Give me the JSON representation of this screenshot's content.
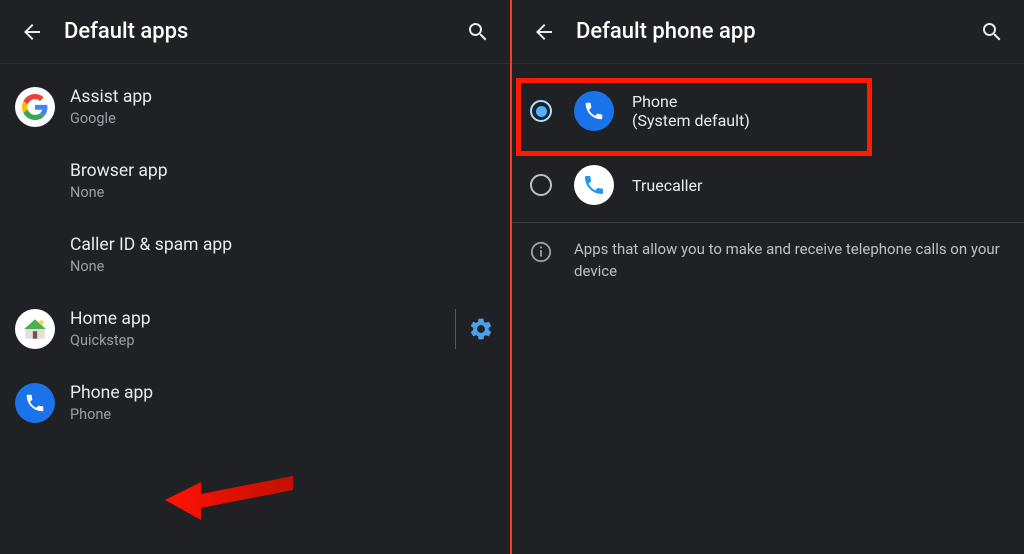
{
  "left": {
    "title": "Default apps",
    "items": [
      {
        "label": "Assist app",
        "value": "Google",
        "icon": "google"
      },
      {
        "label": "Browser app",
        "value": "None",
        "icon": ""
      },
      {
        "label": "Caller ID & spam app",
        "value": "None",
        "icon": ""
      },
      {
        "label": "Home app",
        "value": "Quickstep",
        "icon": "home",
        "gear": true
      },
      {
        "label": "Phone app",
        "value": "Phone",
        "icon": "phone-blue"
      }
    ]
  },
  "right": {
    "title": "Default phone app",
    "options": [
      {
        "label": "Phone",
        "sublabel": "(System default)",
        "icon": "phone-blue",
        "selected": true
      },
      {
        "label": "Truecaller",
        "sublabel": "",
        "icon": "truecaller",
        "selected": false
      }
    ],
    "info_text": "Apps that allow you to make and receive telephone calls on your device"
  }
}
